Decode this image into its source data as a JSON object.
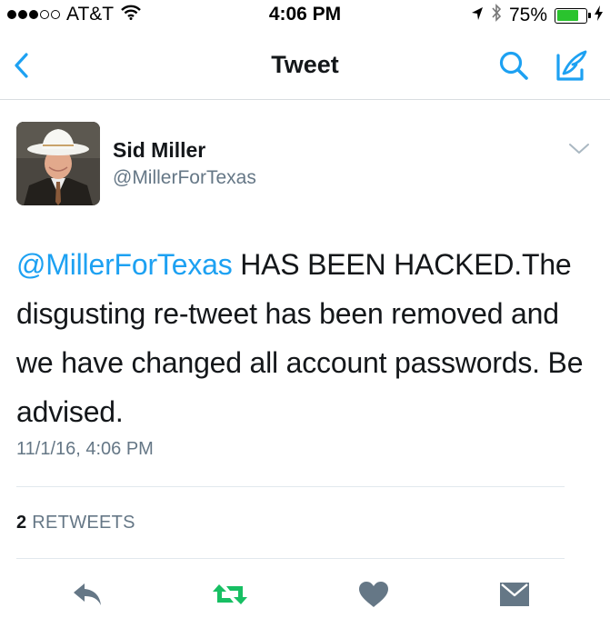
{
  "status_bar": {
    "carrier": "AT&T",
    "time": "4:06 PM",
    "battery_percent": "75%",
    "battery_level": 0.75,
    "signal_bars_filled": 3,
    "signal_bars_total": 5,
    "icons": [
      "wifi-icon",
      "location-arrow-icon",
      "bluetooth-icon",
      "battery-icon",
      "charging-icon"
    ]
  },
  "nav": {
    "title": "Tweet",
    "back_icon": "back-chevron-icon",
    "search_icon": "search-icon",
    "compose_icon": "compose-tweet-icon"
  },
  "tweet": {
    "author_name": "Sid Miller",
    "author_handle": "@MillerForTexas",
    "mention": "@MillerForTexas",
    "text": " HAS BEEN HACKED.The disgusting re-tweet has been removed and we have changed all account passwords.  Be advised.",
    "timestamp": "11/1/16, 4:06 PM",
    "retweet_count": "2",
    "retweet_label": "RETWEETS"
  },
  "actions": {
    "icons": [
      "reply-icon",
      "retweet-icon",
      "like-icon",
      "direct-message-icon"
    ]
  },
  "colors": {
    "accent": "#1da1f2",
    "retweet_green": "#17bf63",
    "secondary_text": "#657786",
    "action_gray": "#657786",
    "divider": "#e1e8ed"
  }
}
